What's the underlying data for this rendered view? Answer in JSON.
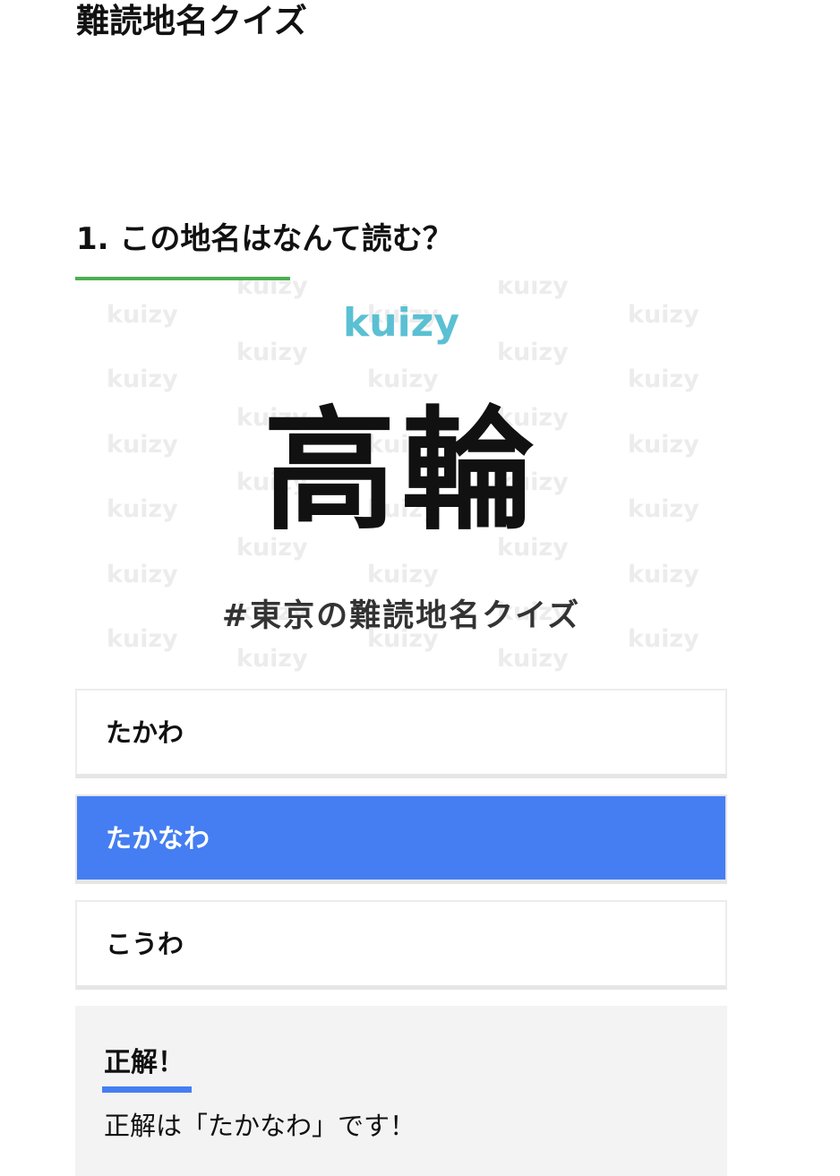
{
  "page": {
    "title": "難読地名クイズ"
  },
  "question": {
    "heading": "1. この地名はなんて読む？",
    "accent_color": "#4caf50"
  },
  "quiz_image": {
    "brand": "kuizy",
    "brand_color": "#5bc0d3",
    "watermark_text": "kuizy",
    "place_name": "高輪",
    "hashtag": "#東京の難読地名クイズ"
  },
  "choices": [
    {
      "label": "たかわ",
      "selected": false
    },
    {
      "label": "たかなわ",
      "selected": true
    },
    {
      "label": "こうわ",
      "selected": false
    }
  ],
  "selected_color": "#457ef2",
  "result": {
    "title": "正解！",
    "message": "正解は「たかなわ」です！"
  }
}
